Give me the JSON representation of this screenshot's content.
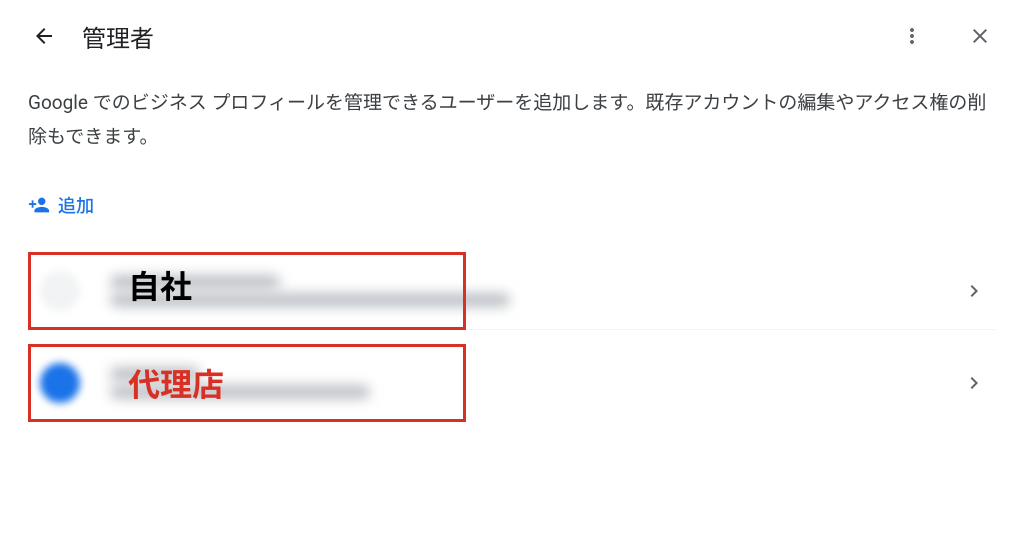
{
  "header": {
    "title": "管理者"
  },
  "description": "Google でのビジネス プロフィールを管理できるユーザーを追加します。既存アカウントの編集やアクセス権の削除もできます。",
  "actions": {
    "add_label": "追加"
  },
  "annotations": {
    "self_company": "自社",
    "agency": "代理店"
  },
  "colors": {
    "accent": "#1a73e8",
    "annotation_red": "#d93025"
  }
}
